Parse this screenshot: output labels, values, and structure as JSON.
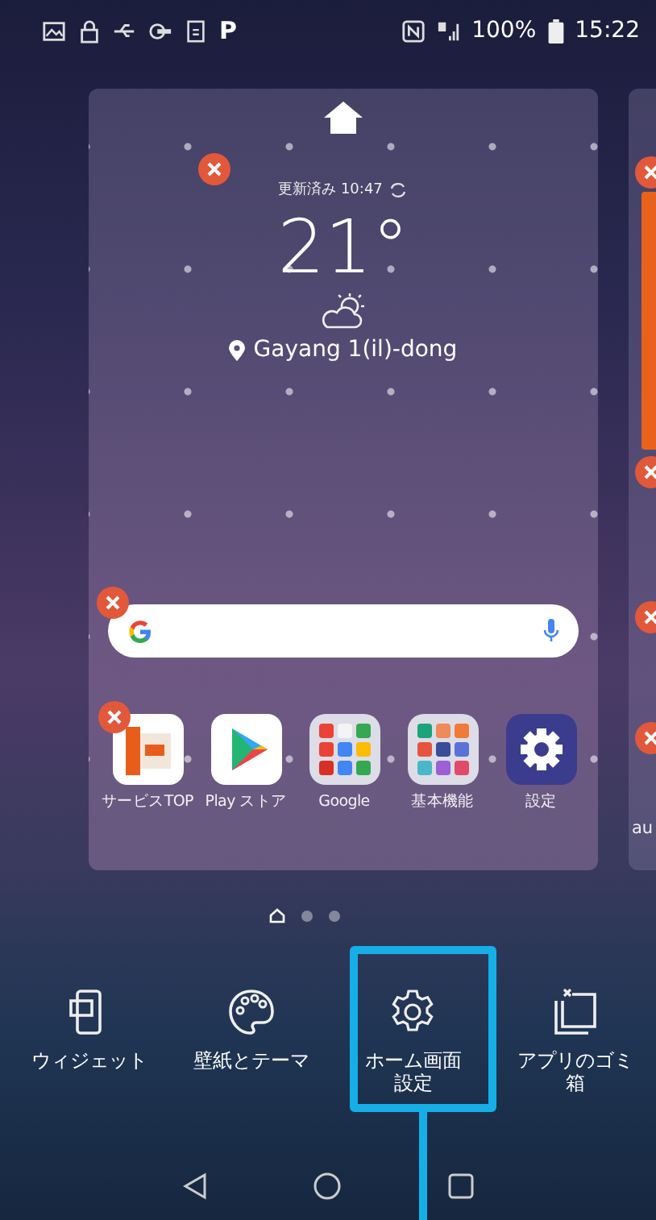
{
  "status_bar": {
    "app_letter": "P",
    "battery": "100%",
    "time": "15:22"
  },
  "home_page": {
    "weather": {
      "removable": true,
      "updated": "更新済み 10:47",
      "temperature": "21°",
      "location": "Gayang 1(il)-dong"
    },
    "search_bar": {
      "removable": true
    },
    "apps": [
      {
        "label": "サービスTOP",
        "kind": "portal",
        "removable": true
      },
      {
        "label": "Play ストア",
        "kind": "store",
        "removable": false
      },
      {
        "label": "Google",
        "kind": "folder",
        "removable": false
      },
      {
        "label": "基本機能",
        "kind": "folder",
        "removable": false
      },
      {
        "label": "設定",
        "kind": "settings",
        "removable": false
      }
    ]
  },
  "next_page": {
    "app_label": "au"
  },
  "page_indicator": [
    {
      "kind": "home",
      "selected": true
    },
    {
      "kind": "dot",
      "selected": false
    },
    {
      "kind": "dot",
      "selected": false
    }
  ],
  "actions": [
    {
      "label": "ウィジェット",
      "kind": "widget",
      "highlighted": false
    },
    {
      "label": "壁紙とテーマ",
      "kind": "palette",
      "highlighted": false
    },
    {
      "label": "ホーム画面設定",
      "kind": "settings",
      "highlighted": true
    },
    {
      "label": "アプリのゴミ箱",
      "kind": "trash",
      "highlighted": false
    }
  ]
}
